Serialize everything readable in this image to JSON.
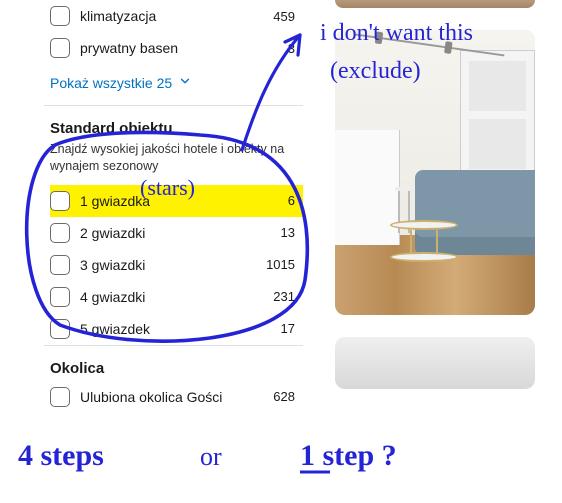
{
  "prev_section": {
    "items": [
      {
        "label": "klimatyzacja",
        "count": 459
      },
      {
        "label": "prywatny basen",
        "count": 3
      }
    ],
    "show_all": "Pokaż wszystkie 25"
  },
  "standard": {
    "title": "Standard obiektu",
    "subtitle": "Znajdź wysokiej jakości hotele i obiekty na wynajem sezonowy",
    "items": [
      {
        "label": "1 gwiazdka",
        "count": 6,
        "highlight": true
      },
      {
        "label": "2 gwiazdki",
        "count": 13
      },
      {
        "label": "3 gwiazdki",
        "count": 1015
      },
      {
        "label": "4 gwiazdki",
        "count": 231
      },
      {
        "label": "5 gwiazdek",
        "count": 17
      }
    ]
  },
  "okolica": {
    "title": "Okolica",
    "items": [
      {
        "label": "Ulubiona okolica Gości",
        "count": 628
      }
    ]
  },
  "annotations": {
    "top_right_1": "i don't want this",
    "top_right_2": "(exclude)",
    "stars_note": "(stars)",
    "bottom_left": "4 steps",
    "bottom_mid": "or",
    "bottom_right": "1 step ?"
  },
  "colors": {
    "link": "#0071c2",
    "highlight": "#fff200",
    "ink": "#2424d6"
  }
}
